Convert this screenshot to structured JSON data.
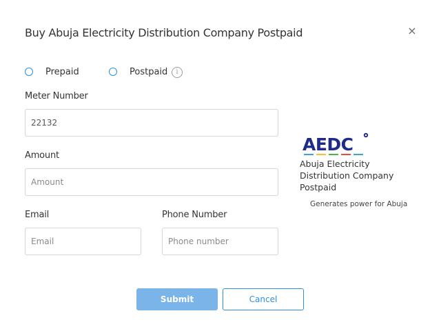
{
  "dialog": {
    "title": "Buy Abuja Electricity Distribution Company Postpaid",
    "close_label": "×"
  },
  "payment_type": {
    "options": [
      {
        "label": "Prepaid",
        "selected": false
      },
      {
        "label": "Postpaid",
        "selected": false
      }
    ],
    "info_icon": "i"
  },
  "form": {
    "meter_number": {
      "label": "Meter Number",
      "value": "22132",
      "placeholder": ""
    },
    "amount": {
      "label": "Amount",
      "value": "",
      "placeholder": "Amount"
    },
    "email": {
      "label": "Email",
      "value": "",
      "placeholder": "Email"
    },
    "phone": {
      "label": "Phone Number",
      "value": "",
      "placeholder": "Phone number"
    }
  },
  "provider": {
    "logo_text": "AEDC",
    "name": "Abuja Electricity Distribution Company Postpaid",
    "tagline": "Generates power for Abuja",
    "brand_color": "#1f2a8a",
    "stripe_colors": [
      "#3aa0e0",
      "#f2c12e",
      "#43b649",
      "#e84a3c",
      "#3aa0e0"
    ]
  },
  "actions": {
    "submit_label": "Submit",
    "cancel_label": "Cancel"
  },
  "colors": {
    "accent": "#2f8fd8",
    "submit_bg": "#7ab4e8"
  }
}
